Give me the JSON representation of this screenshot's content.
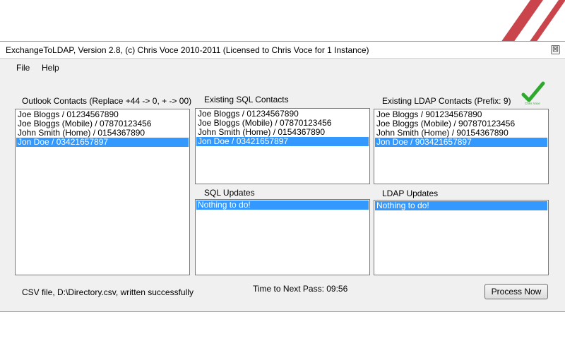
{
  "window": {
    "title": "ExchangeToLDAP, Version 2.8, (c) Chris Voce 2010-2011 (Licensed to Chris Voce for 1 Instance)",
    "close_glyph": "☒"
  },
  "menu": [
    "File",
    "Help"
  ],
  "logo": {
    "text": "Chris Voce",
    "color": "#2fa82f"
  },
  "outlook": {
    "label": "Outlook Contacts (Replace +44 -> 0, + -> 00)",
    "items": [
      "Joe Bloggs / 01234567890",
      "Joe Bloggs (Mobile) / 07870123456",
      "John Smith (Home) / 0154367890",
      "Jon Doe / 03421657897"
    ],
    "selected_index": 3
  },
  "sql_contacts": {
    "label": "Existing SQL Contacts",
    "items": [
      "Joe Bloggs / 01234567890",
      "Joe Bloggs (Mobile) / 07870123456",
      "John Smith (Home) / 0154367890",
      "Jon Doe / 03421657897"
    ],
    "selected_index": 3
  },
  "ldap_contacts": {
    "label": "Existing LDAP Contacts (Prefix: 9)",
    "items": [
      "Joe Bloggs / 901234567890",
      "Joe Bloggs (Mobile) / 907870123456",
      "John Smith (Home) / 90154367890",
      "Jon Doe / 903421657897"
    ],
    "selected_index": 3
  },
  "sql_updates": {
    "label": "SQL Updates",
    "items": [
      "Nothing to do!"
    ],
    "selected_index": 0
  },
  "ldap_updates": {
    "label": "LDAP Updates",
    "items": [
      "Nothing to do!"
    ],
    "selected_index": 0
  },
  "status": {
    "csv_message": "CSV file, D:\\Directory.csv, written successfully",
    "timer": "Time to Next Pass: 09:56"
  },
  "buttons": {
    "process_now": "Process Now"
  },
  "colors": {
    "selection": "#3399ff",
    "window_bg": "#f0f0f0"
  }
}
